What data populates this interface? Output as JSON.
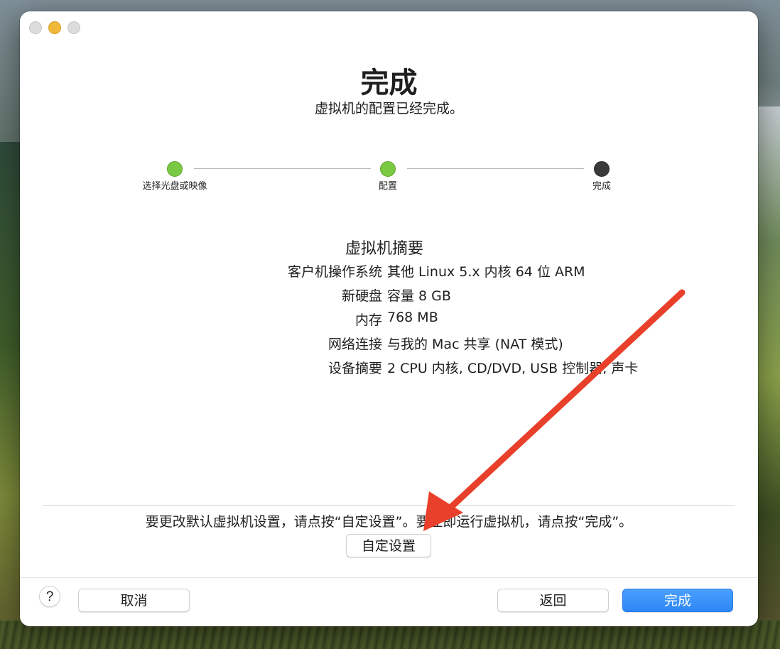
{
  "window": {
    "title": "完成",
    "subtitle": "虚拟机的配置已经完成。"
  },
  "stepper": {
    "steps": [
      {
        "label": "选择光盘或映像",
        "status": "done"
      },
      {
        "label": "配置",
        "status": "done"
      },
      {
        "label": "完成",
        "status": "current"
      }
    ]
  },
  "summary": {
    "title": "虚拟机摘要",
    "rows": [
      {
        "key": "客户机操作系统",
        "value": "其他 Linux 5.x 内核 64 位 ARM"
      },
      {
        "key": "新硬盘",
        "value": "容量 8 GB"
      },
      {
        "key": "内存",
        "value": "768 MB"
      },
      {
        "key": "网络连接",
        "value": "与我的 Mac 共享 (NAT 模式)"
      },
      {
        "key": "设备摘要",
        "value": "2 CPU 内核, CD/DVD, USB 控制器, 声卡"
      }
    ]
  },
  "hint": "要更改默认虚拟机设置，请点按“自定设置”。要立即运行虚拟机，请点按“完成”。",
  "buttons": {
    "custom": "自定设置",
    "help": "?",
    "cancel": "取消",
    "back": "返回",
    "finish": "完成"
  },
  "colors": {
    "step_done": "#7ac943",
    "step_current": "#3a3a3a",
    "primary": "#2d86f5",
    "annotation_arrow": "#e8402a"
  }
}
